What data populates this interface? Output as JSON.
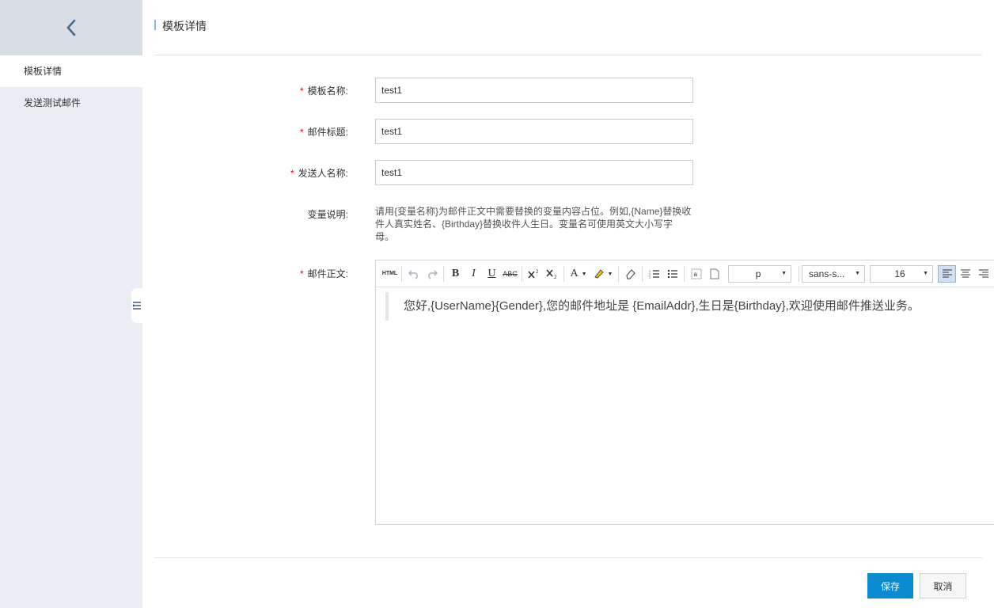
{
  "sidebar": {
    "items": [
      {
        "label": "模板详情",
        "active": true
      },
      {
        "label": "发送测试邮件",
        "active": false
      }
    ]
  },
  "header": {
    "title": "模板详情"
  },
  "form": {
    "required_mark": "*",
    "name": {
      "label": "模板名称:",
      "value": "test1"
    },
    "subject": {
      "label": "邮件标题:",
      "value": "test1"
    },
    "sender": {
      "label": "发送人名称:",
      "value": "test1"
    },
    "variables": {
      "label": "变量说明:",
      "text": "请用{变量名称}为邮件正文中需要替换的变量内容占位。例如,{Name}替换收件人真实姓名、{Birthday}替换收件人生日。变量名可使用英文大小写字母。"
    },
    "body": {
      "label": "邮件正文:"
    }
  },
  "editor": {
    "toolbar": {
      "html_label": "HTML",
      "bold": "B",
      "italic": "I",
      "underline": "U",
      "strike": "ABC",
      "font_color": "A",
      "paragraph_select": "p",
      "font_family_select": "sans-s...",
      "font_size_select": "16"
    },
    "content": "您好,{UserName}{Gender},您的邮件地址是 {EmailAddr},生日是{Birthday},欢迎使用邮件推送业务。"
  },
  "footer": {
    "save_label": "保存",
    "cancel_label": "取消"
  },
  "colors": {
    "primary": "#0a8ad0",
    "required": "#e0001b",
    "sidebar_bg": "#eaedf1"
  }
}
